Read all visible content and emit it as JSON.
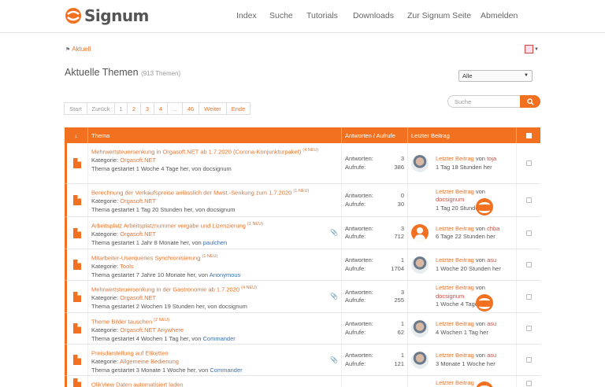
{
  "brand": {
    "name": "Signum",
    "accent": "#f27121"
  },
  "nav": {
    "items": [
      "Index",
      "Suche",
      "Tutorials",
      "Downloads",
      "Zur Signum Seite",
      "Abmelden"
    ]
  },
  "breadcrumb": {
    "label": "Aktuell"
  },
  "page": {
    "title": "Aktuelle Themen",
    "count": "(913 Themen)"
  },
  "filter": {
    "selected": "Alle"
  },
  "search": {
    "placeholder": "Suche"
  },
  "pager": {
    "items": [
      "Start",
      "Zurück",
      "1",
      "2",
      "3",
      "4",
      "...",
      "46",
      "Weiter",
      "Ende"
    ]
  },
  "table": {
    "headers": {
      "thema": "Thema",
      "stats": "Antworten / Aufrufe",
      "last": "Letzter Beitrag"
    },
    "rows": [
      {
        "title": "Mehrwertsteuersenkung in Orgasoft.NET ab 1.7.2020 (Corona-Konjunkturpaket)",
        "neu": "(4 NEU)",
        "category_label": "Kategorie:",
        "category": "Orgasoft.NET",
        "started": "Thema gestartet 1 Woche 4 Tage her, von",
        "starter": "docsignum",
        "answers_label": "Antworten:",
        "answers": "3",
        "views_label": "Aufrufe:",
        "views": "386",
        "lp_label": "Letzter Beitrag",
        "lp_von": "von",
        "lp_user": "toja",
        "lp_time": "1 Tag 18 Stunden her",
        "avatar": "photo"
      },
      {
        "title": "Berechnung der Verkaufspreise anlässlich der Mwst.-Senkung zum 1.7.2020",
        "neu": "(1 NEU)",
        "category_label": "Kategorie:",
        "category": "Orgasoft.NET",
        "started": "Thema gestartet 1 Tag 20 Stunden her, von",
        "starter": "docsignum",
        "answers_label": "Antworten:",
        "answers": "0",
        "views_label": "Aufrufe:",
        "views": "30",
        "lp_label": "Letzter Beitrag",
        "lp_von": "von",
        "lp_user": "docsignum",
        "lp_time": "1 Tag 20 Stunden her",
        "avatar": "logo"
      },
      {
        "title": "Arbeitsplatz Arbeitsplatznummer vergabe und Lizenzierung",
        "neu": "(1 NEU)",
        "category_label": "Kategorie:",
        "category": "Orgasoft.NET",
        "started": "Thema gestartet 1 Jahr 8 Monate her, von",
        "starter": "paulchen",
        "answers_label": "Antworten:",
        "answers": "3",
        "views_label": "Aufrufe:",
        "views": "712",
        "lp_label": "Letzter Beitrag",
        "lp_von": "von",
        "lp_user": "chba",
        "lp_time": "6 Tage 22 Stunden her",
        "avatar": "generic"
      },
      {
        "title": "Mitarbeiter-Userqueries Synchronisierung",
        "neu": "(1 NEU)",
        "category_label": "Kategorie:",
        "category": "Tools",
        "started": "Thema gestartet 7 Jahre 10 Monate her, von",
        "starter": "Anonymous",
        "answers_label": "Antworten:",
        "answers": "1",
        "views_label": "Aufrufe:",
        "views": "1704",
        "lp_label": "Letzter Beitrag",
        "lp_von": "von",
        "lp_user": "asu",
        "lp_time": "1 Woche 20 Stunden her",
        "avatar": "photo"
      },
      {
        "title": "Mehrwertsteuersenkung in der Gastronomie ab 1.7.2020",
        "neu": "(4 NEU)",
        "category_label": "Kategorie:",
        "category": "Orgasoft.NET",
        "started": "Thema gestartet 2 Wochen 19 Stunden her, von",
        "starter": "docsignum",
        "answers_label": "Antworten:",
        "answers": "3",
        "views_label": "Aufrufe:",
        "views": "255",
        "lp_label": "Letzter Beitrag",
        "lp_von": "von",
        "lp_user": "docsignum",
        "lp_time": "1 Woche 4 Tage her",
        "avatar": "logo"
      },
      {
        "title": "Theme Bilder tauschen",
        "neu": "(2 NEU)",
        "category_label": "Kategorie:",
        "category": "Orgasoft.NET Anywhere",
        "started": "Thema gestartet 4 Wochen 1 Tag her, von",
        "starter": "Commander",
        "answers_label": "Antworten:",
        "answers": "1",
        "views_label": "Aufrufe:",
        "views": "62",
        "lp_label": "Letzter Beitrag",
        "lp_von": "von",
        "lp_user": "asu",
        "lp_time": "4 Wochen 1 Tag her",
        "avatar": "photo"
      },
      {
        "title": "Preisdarstellung auf Etiketten",
        "neu": "",
        "category_label": "Kategorie:",
        "category": "Allgemeine Bedienung",
        "started": "Thema gestartet 3 Monate 1 Woche her, von",
        "starter": "Commander",
        "answers_label": "Antworten:",
        "answers": "1",
        "views_label": "Aufrufe:",
        "views": "121",
        "lp_label": "Letzter Beitrag",
        "lp_von": "von",
        "lp_user": "asu",
        "lp_time": "3 Monate 1 Woche her",
        "avatar": "photo"
      },
      {
        "title": "QlikView Daten automatisiert laden",
        "neu": "",
        "category_label": "",
        "category": "",
        "started": "",
        "starter": "",
        "answers_label": "",
        "answers": "",
        "views_label": "",
        "views": "",
        "lp_label": "Letzter Beitrag",
        "lp_von": "",
        "lp_user": "",
        "lp_time": "",
        "avatar": "logo"
      }
    ]
  }
}
